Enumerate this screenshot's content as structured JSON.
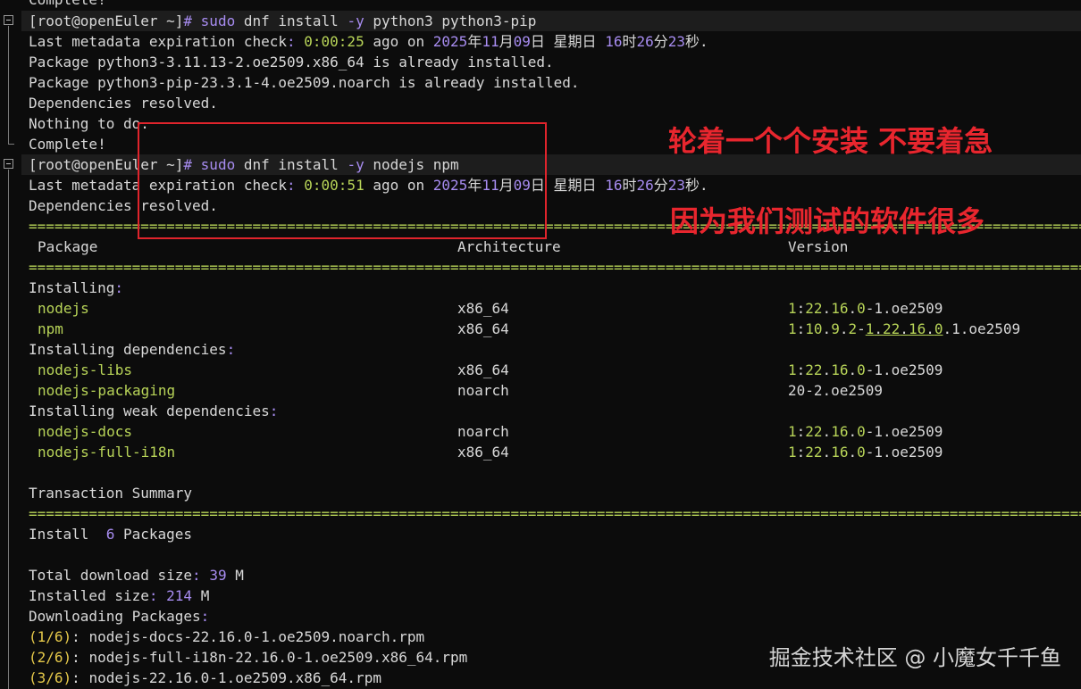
{
  "terminal": {
    "top_partial": "Complete!",
    "block1": {
      "prompt": "[root@openEuler ~]",
      "hash": "#",
      "cmd": "sudo",
      "args1": "dnf install",
      "flag": "-y",
      "args2": "python3 python3-pip",
      "meta_prefix": "Last metadata expiration check",
      "meta_colon": ":",
      "meta_time": "0:00:25",
      "meta_ago": "ago on",
      "date_year": "2025",
      "date_y_ch": "年",
      "date_month": "11",
      "date_m_ch": "月",
      "date_day": "09",
      "date_d_ch": "日",
      "weekday": "星期日",
      "hour": "16",
      "hour_ch": "时",
      "minute": "26",
      "minute_ch": "分",
      "second": "23",
      "second_ch": "秒",
      "dot": ".",
      "pkg1": "Package python3-3.11.13-2.oe2509.x86_64 is already installed.",
      "pkg2": "Package python3-pip-23.3.1-4.oe2509.noarch is already installed.",
      "deps": "Dependencies resolved.",
      "nothing": "Nothing to do.",
      "complete": "Complete!"
    },
    "block2": {
      "prompt": "[root@openEuler ~]",
      "hash": "#",
      "cmd": "sudo",
      "args1": "dnf install",
      "flag": "-y",
      "args2": "nodejs npm",
      "meta_prefix": "Last metadata expiration check",
      "meta_colon": ":",
      "meta_time": "0:00:51",
      "meta_ago": "ago on",
      "date_year": "2025",
      "date_y_ch": "年",
      "date_month": "11",
      "date_m_ch": "月",
      "date_day": "09",
      "date_d_ch": "日",
      "weekday": "星期日",
      "hour": "16",
      "hour_ch": "时",
      "minute": "26",
      "minute_ch": "分",
      "second": "23",
      "second_ch": "秒",
      "dot": ".",
      "deps": "Dependencies resolved."
    },
    "separator": "================================================================================================================================",
    "table_headers": {
      "package": "Package",
      "arch": "Architecture",
      "version": "Version"
    },
    "groups": [
      {
        "title": "Installing",
        "rows": [
          {
            "name": "nodejs",
            "arch": "x86_64",
            "version": "1:22.16.0-1.oe2509"
          },
          {
            "name": "npm",
            "arch": "x86_64",
            "version": "1:10.9.2-1.22.16.0.1.oe2509"
          }
        ]
      },
      {
        "title": "Installing dependencies",
        "rows": [
          {
            "name": "nodejs-libs",
            "arch": "x86_64",
            "version": "1:22.16.0-1.oe2509"
          },
          {
            "name": "nodejs-packaging",
            "arch": "noarch",
            "version": "20-2.oe2509"
          }
        ]
      },
      {
        "title": "Installing weak dependencies",
        "rows": [
          {
            "name": "nodejs-docs",
            "arch": "noarch",
            "version": "1:22.16.0-1.oe2509"
          },
          {
            "name": "nodejs-full-i18n",
            "arch": "x86_64",
            "version": "1:22.16.0-1.oe2509"
          }
        ]
      }
    ],
    "summary_title": "Transaction Summary",
    "install_label": "Install",
    "install_count": "6",
    "install_unit": "Packages",
    "download_label": "Total download size",
    "download_value": "39",
    "download_unit": "M",
    "installed_label": "Installed size",
    "installed_value": "214",
    "installed_unit": "M",
    "downloading": "Downloading Packages",
    "downloads": [
      {
        "idx": "(1/6)",
        "file": "nodejs-docs-22.16.0-1.oe2509.noarch.rpm"
      },
      {
        "idx": "(2/6)",
        "file": "nodejs-full-i18n-22.16.0-1.oe2509.x86_64.rpm"
      },
      {
        "idx": "(3/6)",
        "file": "nodejs-22.16.0-1.oe2509.x86_64.rpm"
      }
    ]
  },
  "annotations": {
    "note1": "轮着一个个安装 不要着急",
    "note2": "因为我们测试的软件很多",
    "accent": "#e8262e"
  },
  "watermark": "掘金技术社区 @ 小魔女千千鱼"
}
